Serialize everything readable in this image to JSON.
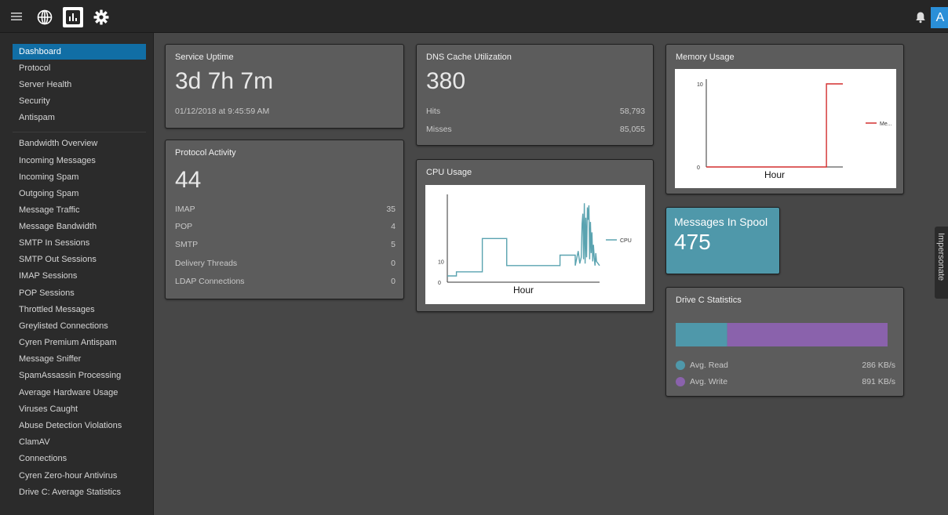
{
  "colors": {
    "accent_blue": "#116ea5",
    "cpu_line": "#5aa3b0",
    "memory_line": "#d32f2f",
    "spool_bg": "#4f98aa",
    "drive_read": "#4f98aa",
    "drive_write": "#8a62ac",
    "avatar_bg": "#2a8fd8"
  },
  "topbar": {
    "icons": [
      "menu-icon",
      "globe-icon",
      "bar-chart-icon",
      "gear-icon",
      "bell-icon"
    ],
    "avatar_letter": "A"
  },
  "sidebar": {
    "items": [
      {
        "label": "Dashboard",
        "active": true
      },
      {
        "label": "Protocol"
      },
      {
        "label": "Server Health"
      },
      {
        "label": "Security"
      },
      {
        "label": "Antispam"
      },
      {
        "label": "Bandwidth Overview"
      },
      {
        "label": "Incoming Messages"
      },
      {
        "label": "Incoming Spam"
      },
      {
        "label": "Outgoing Spam"
      },
      {
        "label": "Message Traffic"
      },
      {
        "label": "Message Bandwidth"
      },
      {
        "label": "SMTP In Sessions"
      },
      {
        "label": "SMTP Out Sessions"
      },
      {
        "label": "IMAP Sessions"
      },
      {
        "label": "POP Sessions"
      },
      {
        "label": "Throttled Messages"
      },
      {
        "label": "Greylisted Connections"
      },
      {
        "label": "Cyren Premium Antispam"
      },
      {
        "label": "Message Sniffer"
      },
      {
        "label": "SpamAssassin Processing"
      },
      {
        "label": "Average Hardware Usage"
      },
      {
        "label": "Viruses Caught"
      },
      {
        "label": "Abuse Detection Violations"
      },
      {
        "label": "ClamAV"
      },
      {
        "label": "Connections"
      },
      {
        "label": "Cyren Zero-hour Antivirus"
      },
      {
        "label": "Drive C: Average Statistics"
      }
    ]
  },
  "uptime": {
    "title": "Service Uptime",
    "value": "3d 7h 7m",
    "since": "01/12/2018 at 9:45:59 AM"
  },
  "protocol": {
    "title": "Protocol Activity",
    "total": "44",
    "rows": [
      {
        "label": "IMAP",
        "value": "35"
      },
      {
        "label": "POP",
        "value": "4"
      },
      {
        "label": "SMTP",
        "value": "5"
      },
      {
        "label": "Delivery Threads",
        "value": "0"
      },
      {
        "label": "LDAP Connections",
        "value": "0"
      }
    ]
  },
  "dns": {
    "title": "DNS Cache Utilization",
    "total": "380",
    "rows": [
      {
        "label": "Hits",
        "value": "58,793"
      },
      {
        "label": "Misses",
        "value": "85,055"
      }
    ]
  },
  "cpu": {
    "title": "CPU Usage",
    "chart_data": {
      "type": "line",
      "xlabel": "Hour",
      "ylabel": "",
      "ylim": [
        0,
        40
      ],
      "yticks": [
        0,
        10
      ],
      "series": [
        {
          "name": "CPU",
          "x": [
            0,
            0.06,
            0.06,
            0.23,
            0.23,
            0.39,
            0.39,
            0.56,
            0.56,
            0.74,
            0.74,
            0.84,
            0.84,
            0.86,
            0.87,
            0.88,
            0.885,
            0.89,
            0.895,
            0.9,
            0.905,
            0.91,
            0.915,
            0.92,
            0.925,
            0.93,
            0.935,
            0.94,
            0.945,
            0.95,
            0.955,
            0.96,
            0.965,
            0.97,
            0.975,
            0.98,
            0.99,
            1.0
          ],
          "y": [
            3,
            3,
            5,
            5,
            21,
            21,
            8,
            8,
            8,
            8,
            13,
            13,
            8,
            15,
            9,
            12,
            28,
            33,
            11,
            38,
            9,
            31,
            12,
            36,
            30,
            37,
            11,
            29,
            14,
            24,
            10,
            18,
            12,
            8,
            14,
            10,
            9,
            8
          ]
        }
      ],
      "legend": "right"
    }
  },
  "memory": {
    "title": "Memory Usage",
    "chart_data": {
      "type": "line",
      "xlabel": "Hour",
      "ylabel": "",
      "ylim": [
        0,
        10
      ],
      "yticks": [
        0,
        10
      ],
      "series": [
        {
          "name": "Me...",
          "x": [
            0,
            0.1,
            0.2,
            0.3,
            0.4,
            0.5,
            0.6,
            0.7,
            0.8,
            0.88,
            0.88,
            0.91,
            1.0
          ],
          "y": [
            0,
            0,
            0,
            0,
            0,
            0,
            0,
            0,
            0,
            0,
            10,
            10,
            10
          ]
        }
      ],
      "legend": "right"
    }
  },
  "spool": {
    "title": "Messages In Spool",
    "value": "475"
  },
  "drive": {
    "title": "Drive C Statistics",
    "chart_data": {
      "type": "bar",
      "orientation": "horizontal-stacked",
      "series": [
        {
          "name": "Avg. Read",
          "value": 286
        },
        {
          "name": "Avg. Write",
          "value": 891
        }
      ]
    },
    "rows": [
      {
        "label": "Avg. Read",
        "value": "286 KB/s"
      },
      {
        "label": "Avg. Write",
        "value": "891 KB/s"
      }
    ]
  },
  "impersonate": {
    "label": "Impersonate"
  }
}
